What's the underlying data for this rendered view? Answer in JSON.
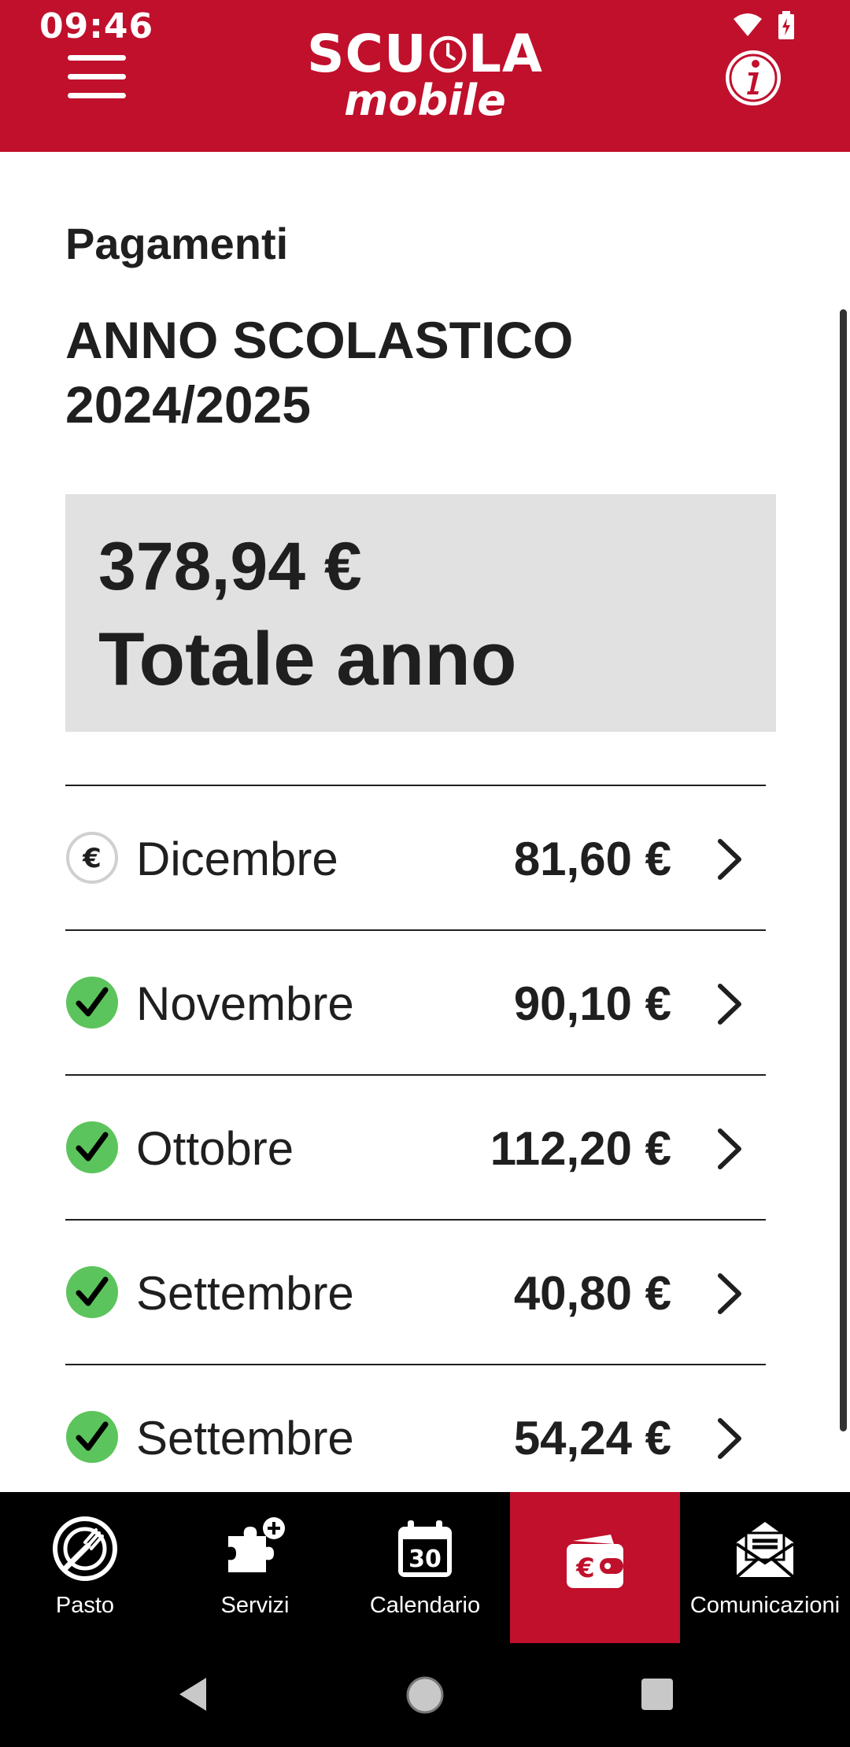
{
  "status_bar": {
    "time": "09:46"
  },
  "header": {
    "logo_top": "SCU LA",
    "logo_top_left": "SCU",
    "logo_top_right": "LA",
    "logo_bottom": "mobile"
  },
  "page": {
    "section_title": "Pagamenti",
    "year_title": "ANNO SCOLASTICO 2024/2025",
    "total_amount": "378,94 €",
    "total_label": "Totale anno"
  },
  "payments": [
    {
      "month": "Dicembre",
      "amount": "81,60 €",
      "status": "pending"
    },
    {
      "month": "Novembre",
      "amount": "90,10 €",
      "status": "paid"
    },
    {
      "month": "Ottobre",
      "amount": "112,20 €",
      "status": "paid"
    },
    {
      "month": "Settembre",
      "amount": "40,80 €",
      "status": "paid"
    },
    {
      "month": "Settembre",
      "amount": "54,24 €",
      "status": "paid"
    }
  ],
  "bottom_nav": [
    {
      "label": "Pasto",
      "icon": "meal-icon"
    },
    {
      "label": "Servizi",
      "icon": "services-icon"
    },
    {
      "label": "Calendario",
      "icon": "calendar-icon",
      "calendar_day": "30"
    },
    {
      "label": "",
      "icon": "wallet-euro-icon",
      "active": true
    },
    {
      "label": "Comunicazioni",
      "icon": "mail-icon"
    }
  ],
  "colors": {
    "brand": "#c0102c",
    "paid": "#5cc45c",
    "pending_border": "#d0d0d0",
    "total_bg": "#e1e1e1"
  }
}
